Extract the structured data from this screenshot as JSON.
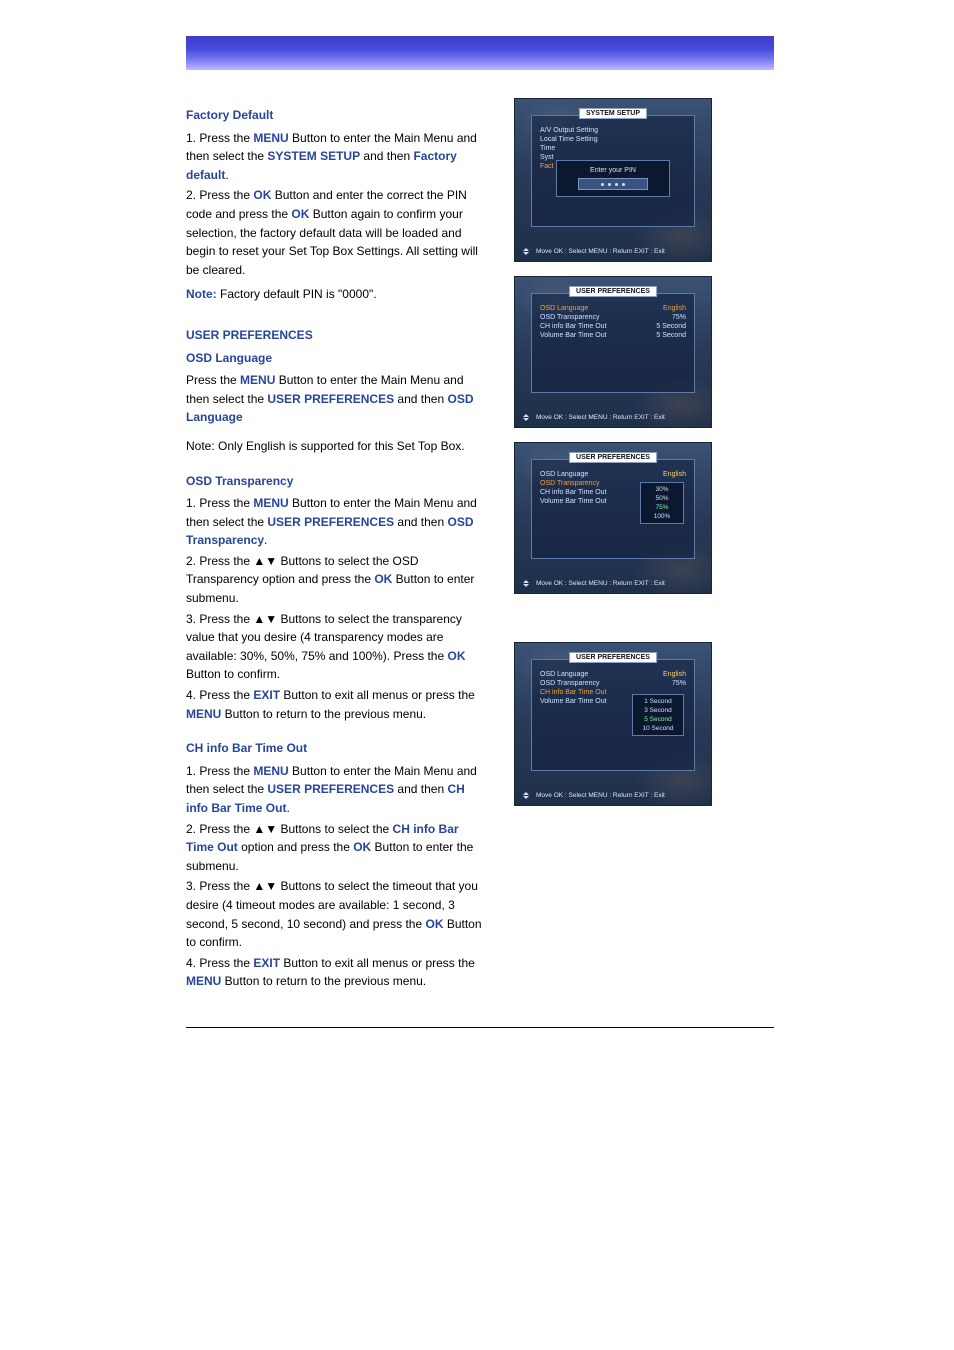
{
  "section1": {
    "heading": "Factory Default",
    "p1a": "1. Press the ",
    "p1_btn1": "MENU",
    "p1b": " Button to enter the Main Menu and then select the ",
    "p1_opt1": "SYSTEM SETUP",
    "p1c": " and then ",
    "p1_opt2": "Factory default",
    "p1d": ".",
    "p2a": "2. Press the ",
    "p2_btn1": "OK",
    "p2b": " Button and enter the correct the PIN code and press the ",
    "p2_btn2": "OK",
    "p2c": " Button again to confirm your selection, the factory default data will be loaded and begin to reset your Set Top Box Settings. All setting will be cleared.",
    "notelabel": "Note:",
    "noteval": " Factory default PIN is \"0000\"."
  },
  "section2": {
    "heading": "USER PREFERENCES",
    "sub1": "OSD Language",
    "p1a": "Press the ",
    "p1_btn1": "MENU",
    "p1b": " Button to enter the Main Menu and then select the ",
    "p1_opt1": "USER PREFERENCES",
    "p1c": " and then ",
    "p1_opt2": "OSD Language",
    "note": "Note: Only English is supported for this Set Top Box."
  },
  "section3": {
    "sub": "OSD Transparency",
    "p1a": "1. Press the ",
    "p1_btn1": "MENU",
    "p1b": " Button to enter the Main Menu and then select the ",
    "p1_opt1": "USER PREFERENCES",
    "p1c": " and then ",
    "p1_opt2": "OSD Transparency",
    "p1d": ".",
    "p2": "2. Press the ▲▼ Buttons to select the OSD Transparency option and press the ",
    "p2_btn": "OK",
    "p2b": " Button to enter submenu.",
    "p3a": "3. Press the ▲▼ Buttons to select the transparency value that you desire (4 transparency modes are available: 30%, 50%, 75% and 100%). Press the ",
    "p3_btn": "OK",
    "p3b": " Button to confirm.",
    "p4a": "4. Press the ",
    "p4_btn1": "EXIT",
    "p4b": " Button to exit all menus or press the ",
    "p4_btn2": "MENU",
    "p4c": " Button to return to the previous menu."
  },
  "section4": {
    "sub": "CH info Bar Time Out",
    "p1a": "1. Press the ",
    "p1_btn1": "MENU",
    "p1b": " Button to enter the Main Menu and then select the ",
    "p1_opt1": "USER PREFERENCES",
    "p1c": " and then ",
    "p1_opt2": "CH info Bar Time Out",
    "p1d": ".",
    "p2a": "2. Press the ▲▼ Buttons to select the ",
    "p2_opt": "CH info Bar Time Out",
    "p2b": " option and press the ",
    "p2_btn": "OK",
    "p2c": " Button to enter the submenu.",
    "p3a": "3. Press the ▲▼ Buttons to select the timeout that you desire (4 timeout modes are available: 1 second, 3 second, 5 second, 10 second) and press the ",
    "p3_btn": "OK",
    "p3b": " Button to confirm.",
    "p4a": "4. Press the ",
    "p4_btn1": "EXIT",
    "p4b": " Button to exit all menus or press the ",
    "p4_btn2": "MENU",
    "p4c": " Button to return to the previous menu."
  },
  "tv1": {
    "title": "SYSTEM SETUP",
    "r1": "A/V Output Setting",
    "r2": "Local Time Setting",
    "r3": "Time",
    "r4": "Syst",
    "r5": "Fact",
    "dialog": "Enter your PIN",
    "foot": "Move   OK : Select   MENU : Return   EXIT : Exit"
  },
  "tv2": {
    "title": "USER PREFERENCES",
    "r1l": "OSD Language",
    "r1r": "English",
    "r2l": "OSD Transparency",
    "r2r": "75%",
    "r3l": "CH info Bar Time Out",
    "r3r": "5 Second",
    "r4l": "Volume Bar Time Out",
    "r4r": "5 Second",
    "foot": "Move   OK : Select   MENU : Return   EXIT : Exit"
  },
  "tv3": {
    "title": "USER PREFERENCES",
    "r1l": "OSD Language",
    "r1r": "English",
    "r2l": "OSD Transparency",
    "r3l": "CH info Bar Time Out",
    "r4l": "Volume Bar Time Out",
    "opt1": "30%",
    "opt2": "50%",
    "opt3": "75%",
    "opt4": "100%",
    "foot": "Move   OK : Select   MENU : Return   EXIT : Exit"
  },
  "tv4": {
    "title": "USER PREFERENCES",
    "r1l": "OSD Language",
    "r1r": "English",
    "r2l": "OSD Transparency",
    "r2r": "75%",
    "r3l": "CH info Bar Time Out",
    "r4l": "Volume Bar Time Out",
    "opt1": "1 Second",
    "opt2": "3 Second",
    "opt3": "5 Second",
    "opt4": "10 Second",
    "foot": "Move   OK : Select   MENU : Return   EXIT : Exit"
  }
}
